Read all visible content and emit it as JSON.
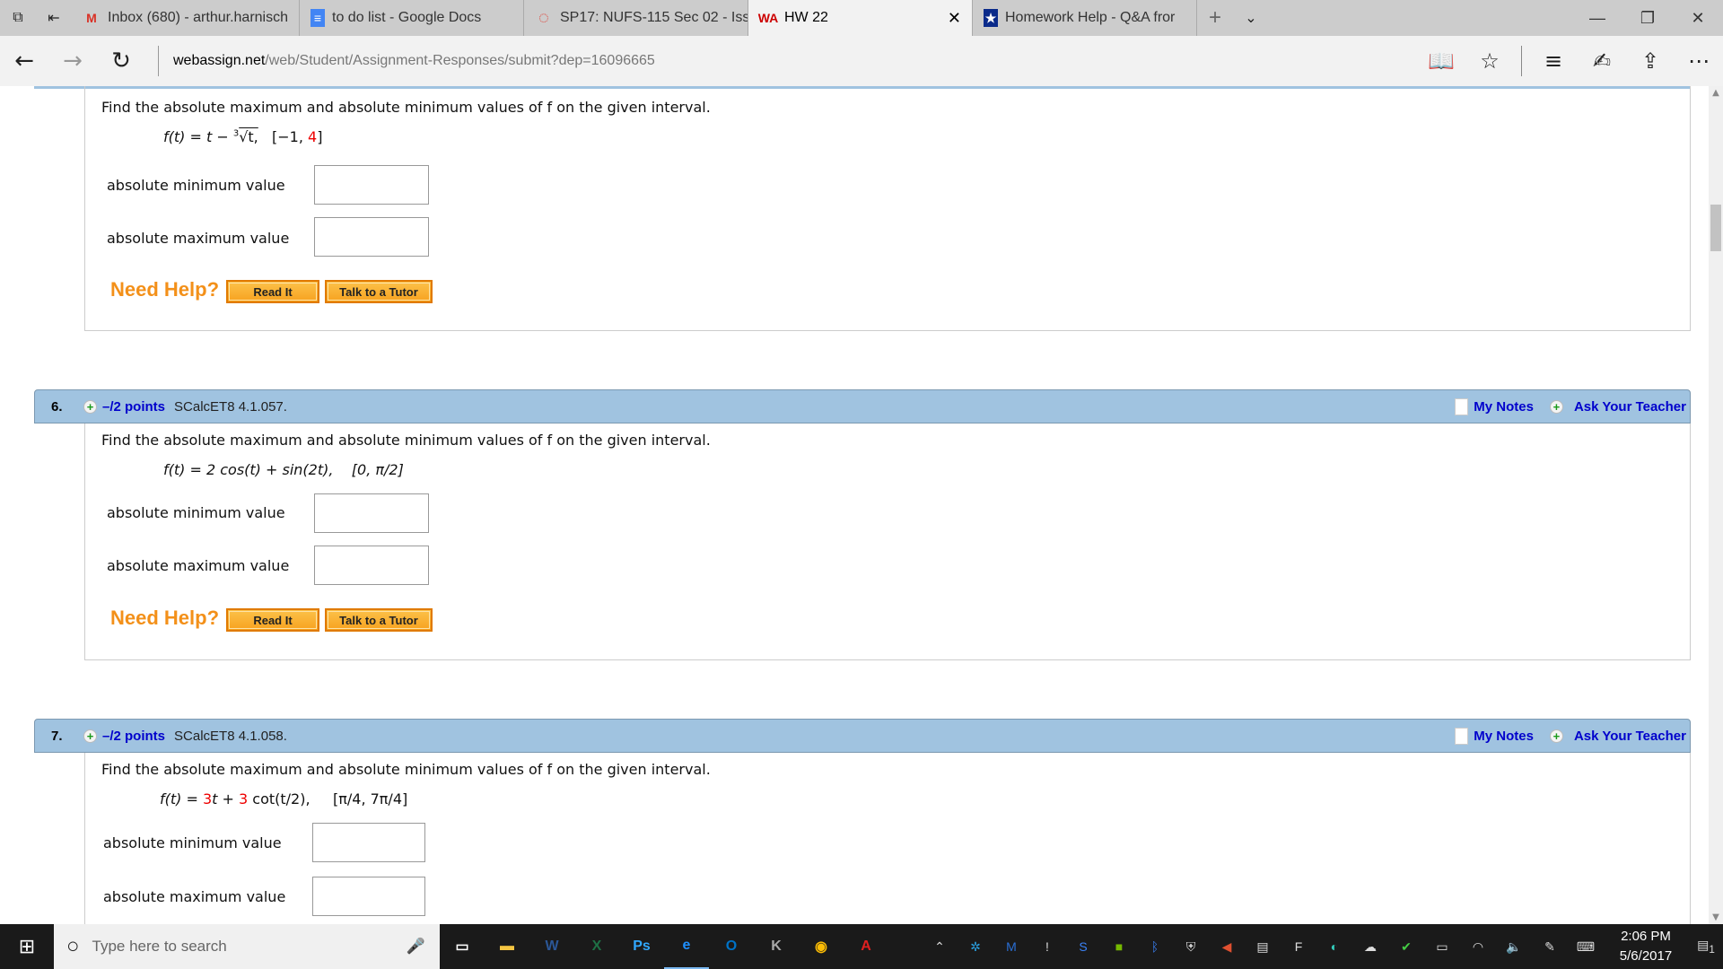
{
  "browser": {
    "tabs": [
      {
        "label": "Inbox (680) - arthur.harnisch",
        "icon": "gmail-icon",
        "color": "#d93025"
      },
      {
        "label": "to do list - Google Docs",
        "icon": "docs-icon",
        "color": "#4285f4"
      },
      {
        "label": "SP17: NUFS-115 Sec 02 - Iss",
        "icon": "canvas-icon",
        "color": "#e03c31"
      },
      {
        "label": "HW 22",
        "icon": "webassign-icon",
        "active": true
      },
      {
        "label": "Homework Help - Q&A fror",
        "icon": "chegg-icon",
        "color": "#0a2a8a"
      }
    ],
    "url_host": "webassign.net",
    "url_path": "/web/Student/Assignment-Responses/submit?dep=16096665"
  },
  "page": {
    "question_text": "Find the absolute maximum and absolute minimum values of f on the given interval.",
    "min_label": "absolute minimum value",
    "max_label": "absolute maximum value",
    "need_help": "Need Help?",
    "read_it": "Read It",
    "talk_tutor": "Talk to a Tutor",
    "my_notes": "My Notes",
    "ask_teacher": "Ask Your Teacher",
    "questions": [
      {
        "formula_parts": [
          "f(t) = t − ",
          "3",
          "√t,",
          "   [−1, ",
          "4",
          "]"
        ]
      },
      {
        "number": "6.",
        "points": "–/2 points",
        "source": "SCalcET8 4.1.057.",
        "formula": "f(t) = 2 cos(t) + sin(2t),    [0, π/2]"
      },
      {
        "number": "7.",
        "points": "–/2 points",
        "source": "SCalcET8 4.1.058.",
        "formula_parts": [
          "f(t) = ",
          "3",
          "t + ",
          "3",
          " cot(t/2),     [π/4, 7π/4]"
        ]
      }
    ],
    "accent_color": "#a0c3e0",
    "link_color": "#0000cc"
  },
  "taskbar": {
    "search_placeholder": "Type here to search",
    "time": "2:06 PM",
    "date": "5/6/2017",
    "notification_count": "1"
  }
}
